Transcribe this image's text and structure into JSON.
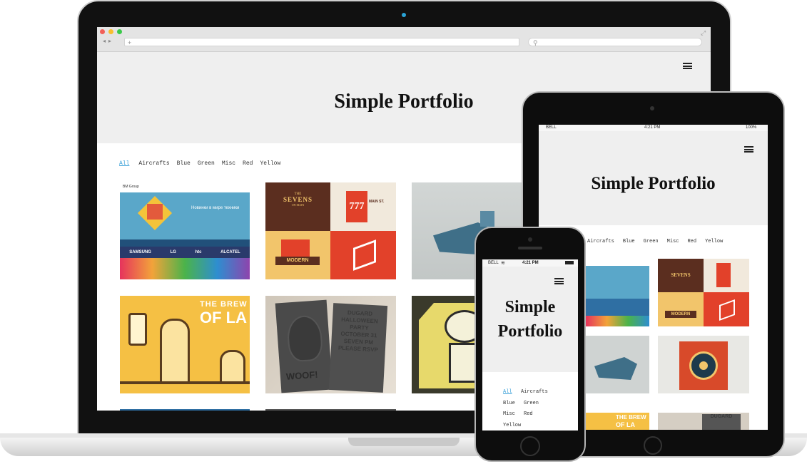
{
  "site": {
    "title": "Simple Portfolio",
    "title_line1": "Simple",
    "title_line2": "Portfolio"
  },
  "filters": [
    "All",
    "Aircrafts",
    "Blue",
    "Green",
    "Misc",
    "Red",
    "Yellow"
  ],
  "tablet_filters": [
    "Aircrafts",
    "Blue",
    "Green",
    "Misc",
    "Red",
    "Yellow"
  ],
  "phone_filters": {
    "row1": [
      "All",
      "Aircrafts"
    ],
    "row2": [
      "Blue",
      "Green"
    ],
    "row3": [
      "Misc",
      "Red"
    ],
    "row4": [
      "Yellow"
    ]
  },
  "status_bar": {
    "carrier": "BELL",
    "time": "4:21 PM",
    "battery": "100%"
  },
  "portfolio": {
    "bm_logo": "BM Group",
    "bm_headline": "Новинки в мире техники",
    "brand_samsung": "SAMSUNG",
    "brand_lg": "LG",
    "brand_htc": "htc",
    "brand_alcatel": "ALCATEL",
    "sevens_line1": "THE",
    "sevens_line2": "SEVENS",
    "sevens_line3": "ON MAIN",
    "sevens_number": "777",
    "main_st": "MAIN ST.",
    "modern_label": "MODERN",
    "brewery_text": "THE BREW",
    "brewery_text2": "OF LA",
    "woof_text": "WOOF!",
    "dugard_text": "DUGARD HALLOWEEN PARTY OCTOBER 31 SEVEN PM PLEASE RSVP",
    "brew_small": "THE BREW",
    "brew_small2": "OF LA",
    "dugard_small": "DUGARD"
  },
  "colors": {
    "accent": "#3aa0d8",
    "hero_bg": "#efefef",
    "tile_blue": "#2f6fa3",
    "tile_brown": "#5b2e1f",
    "tile_red": "#e2412a",
    "tile_yellow": "#f2c56b",
    "tile_beer_yellow": "#f5c044"
  },
  "icons": {
    "menu": "hamburger-menu-icon",
    "search": "search-icon",
    "add_tab": "plus-icon",
    "expand": "expand-icon",
    "wifi": "wifi-icon"
  }
}
